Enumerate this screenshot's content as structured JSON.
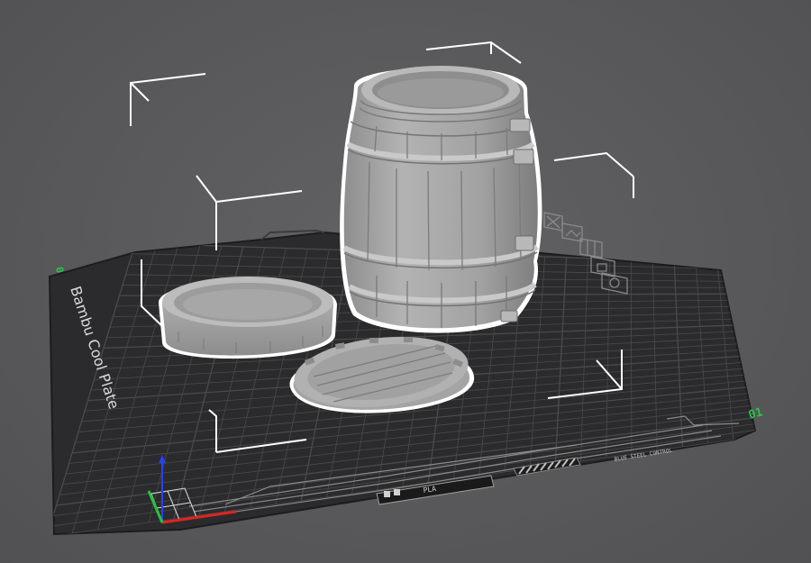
{
  "plate": {
    "label": "Bambu Cool Plate",
    "corner_left": "0",
    "corner_right": "01",
    "bottom_badge": "PLA",
    "warning_text": "BLUE STEEL CONTROL"
  },
  "objects": {
    "barrel": {
      "selected": true
    },
    "lid": {
      "selected": false
    },
    "base": {
      "selected": true
    }
  },
  "colors": {
    "plate": "#2b2b2d",
    "grid_line": "#4a4a4c",
    "model": "#a9a9a9",
    "selection_outline": "#ffffff",
    "axis_x": "#e0251f",
    "axis_y": "#27c23c",
    "axis_z": "#2a3ff0"
  },
  "icons": [
    "close-icon",
    "image-icon",
    "grid-icon",
    "lock-icon",
    "settings-icon"
  ]
}
